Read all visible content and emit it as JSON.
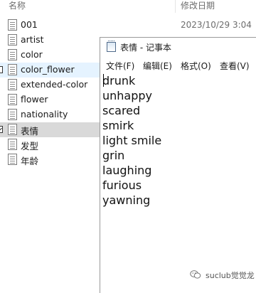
{
  "explorer": {
    "columns": {
      "name": "名称",
      "date": "修改日期"
    },
    "first_date": "2023/10/29 3:04",
    "files": [
      {
        "name": "001",
        "state": "normal"
      },
      {
        "name": "artist",
        "state": "normal"
      },
      {
        "name": "color",
        "state": "normal"
      },
      {
        "name": "color_flower",
        "state": "hover"
      },
      {
        "name": "extended-color",
        "state": "normal"
      },
      {
        "name": "flower",
        "state": "normal"
      },
      {
        "name": "nationality",
        "state": "normal"
      },
      {
        "name": "表情",
        "state": "selected"
      },
      {
        "name": "发型",
        "state": "normal"
      },
      {
        "name": "年龄",
        "state": "normal"
      }
    ]
  },
  "notepad": {
    "title": "表情 - 记事本",
    "menu": {
      "file": "文件(F)",
      "edit": "编辑(E)",
      "format": "格式(O)",
      "view": "查看(V)"
    },
    "lines": [
      "drunk",
      "unhappy",
      "scared",
      "smirk",
      "light smile",
      "grin",
      "laughing",
      "furious",
      "yawning"
    ]
  },
  "watermark": {
    "text": "suclub觉觉龙"
  },
  "colors": {
    "hover_row": "#e5f3ff",
    "selected_row": "#d9d9d9"
  }
}
